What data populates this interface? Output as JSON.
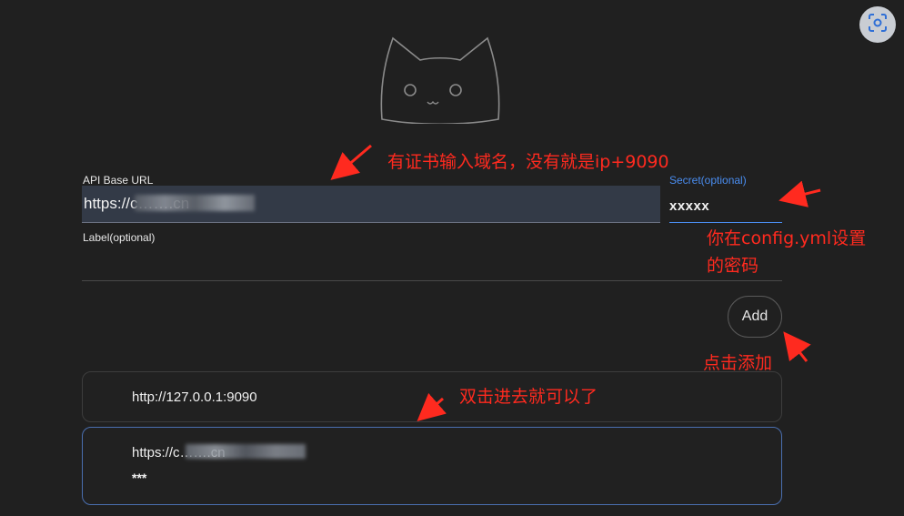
{
  "form": {
    "api_base_url_label": "API Base URL",
    "api_base_url_value": "https://c…….cn",
    "secret_label": "Secret(optional)",
    "secret_value": "xxxxx",
    "label_label": "Label(optional)",
    "add_label": "Add"
  },
  "backends": [
    {
      "url": "http://127.0.0.1:9090",
      "secret": ""
    },
    {
      "url": "https://c…….cn",
      "secret": "***"
    }
  ],
  "annotations": {
    "url_note": "有证书输入域名，没有就是ip+9090",
    "secret_note_line1": "你在config.yml设置",
    "secret_note_line2": "的密码",
    "add_note": "点击添加",
    "list_note": "双击进去就可以了"
  },
  "colors": {
    "background": "#202020",
    "input_bg": "#333a47",
    "accent": "#4a8df0",
    "annotation": "#ff2a1f"
  },
  "icons": {
    "corner": "scan-icon",
    "logo": "cat-logo-icon"
  }
}
